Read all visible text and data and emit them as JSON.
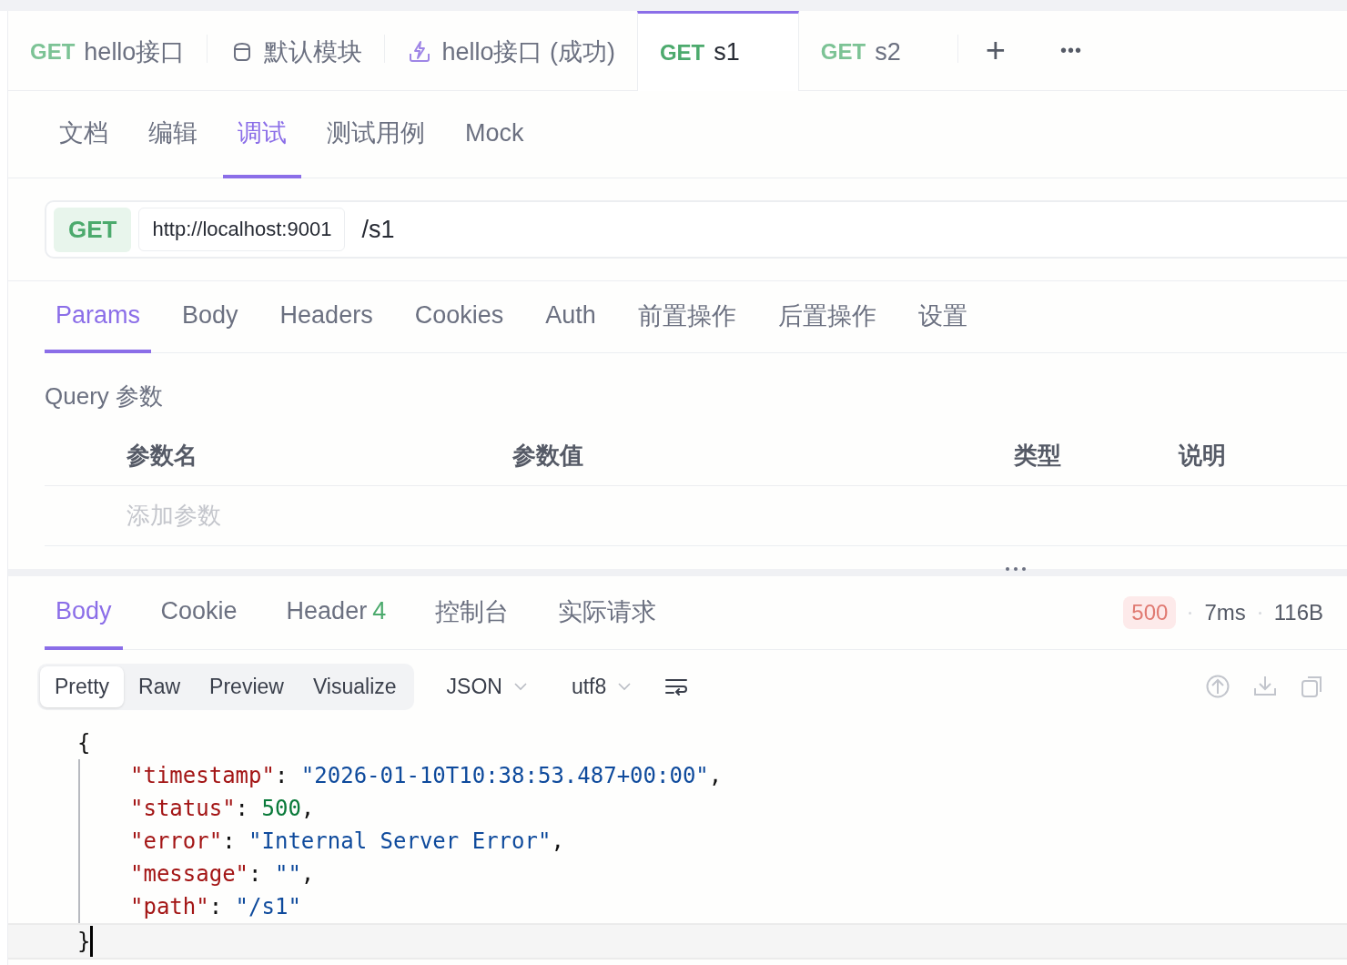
{
  "tabs": [
    {
      "kind": "request",
      "method": "GET",
      "label": "hello接口",
      "selected": false
    },
    {
      "kind": "module",
      "label": "默认模块",
      "selected": false
    },
    {
      "kind": "run",
      "label": "hello接口 (成功)",
      "selected": false
    },
    {
      "kind": "request",
      "method": "GET",
      "label": "s1",
      "selected": true
    },
    {
      "kind": "request",
      "method": "GET",
      "label": "s2",
      "selected": false
    }
  ],
  "tab_actions": [
    "+",
    "•••"
  ],
  "view_tabs": [
    {
      "label": "文档",
      "selected": false
    },
    {
      "label": "编辑",
      "selected": false
    },
    {
      "label": "调试",
      "selected": true
    },
    {
      "label": "测试用例",
      "selected": false
    },
    {
      "label": "Mock",
      "selected": false
    }
  ],
  "url_bar": {
    "method": "GET",
    "base_url": "http://localhost:9001",
    "path": "/s1"
  },
  "request_tabs": [
    {
      "label": "Params",
      "selected": true
    },
    {
      "label": "Body",
      "selected": false
    },
    {
      "label": "Headers",
      "selected": false
    },
    {
      "label": "Cookies",
      "selected": false
    },
    {
      "label": "Auth",
      "selected": false
    },
    {
      "label": "前置操作",
      "selected": false
    },
    {
      "label": "后置操作",
      "selected": false
    },
    {
      "label": "设置",
      "selected": false
    }
  ],
  "query": {
    "title": "Query 参数",
    "columns": [
      "参数名",
      "参数值",
      "类型",
      "说明"
    ],
    "placeholder": "添加参数"
  },
  "response_tabs": [
    {
      "label": "Body",
      "selected": true
    },
    {
      "label": "Cookie",
      "selected": false
    },
    {
      "label": "Header",
      "count": "4",
      "selected": false
    },
    {
      "label": "控制台",
      "selected": false
    },
    {
      "label": "实际请求",
      "selected": false
    }
  ],
  "response_meta": {
    "status": "500",
    "time": "7ms",
    "size": "116B"
  },
  "formats": [
    {
      "label": "Pretty",
      "selected": true
    },
    {
      "label": "Raw",
      "selected": false
    },
    {
      "label": "Preview",
      "selected": false
    },
    {
      "label": "Visualize",
      "selected": false
    }
  ],
  "dropdowns": [
    "JSON",
    "utf8"
  ],
  "code": [
    [
      {
        "kind": "punct",
        "text": "{"
      }
    ],
    [
      {
        "kind": "key",
        "text": "\"timestamp\""
      },
      {
        "kind": "punct",
        "text": ": "
      },
      {
        "kind": "string",
        "text": "\"2026-01-10T10:38:53.487+00:00\""
      },
      {
        "kind": "punct",
        "text": ","
      }
    ],
    [
      {
        "kind": "key",
        "text": "\"status\""
      },
      {
        "kind": "punct",
        "text": ": "
      },
      {
        "kind": "number",
        "text": "500"
      },
      {
        "kind": "punct",
        "text": ","
      }
    ],
    [
      {
        "kind": "key",
        "text": "\"error\""
      },
      {
        "kind": "punct",
        "text": ": "
      },
      {
        "kind": "string",
        "text": "\"Internal Server Error\""
      },
      {
        "kind": "punct",
        "text": ","
      }
    ],
    [
      {
        "kind": "key",
        "text": "\"message\""
      },
      {
        "kind": "punct",
        "text": ": "
      },
      {
        "kind": "string",
        "text": "\"\""
      },
      {
        "kind": "punct",
        "text": ","
      }
    ],
    [
      {
        "kind": "key",
        "text": "\"path\""
      },
      {
        "kind": "punct",
        "text": ": "
      },
      {
        "kind": "string",
        "text": "\"/s1\""
      }
    ],
    [
      {
        "kind": "punct",
        "text": "}"
      }
    ]
  ]
}
